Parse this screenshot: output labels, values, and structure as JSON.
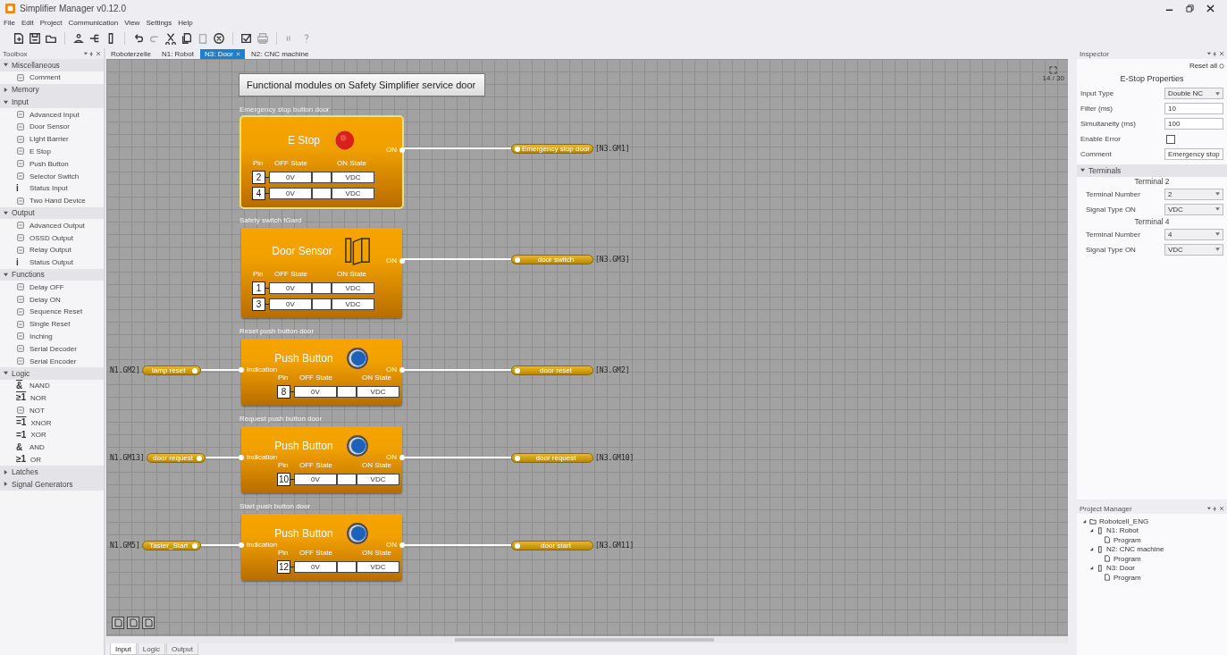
{
  "window": {
    "title": "Simplifier Manager v0.12.0"
  },
  "menu": [
    "File",
    "Edit",
    "Project",
    "Communication",
    "View",
    "Settings",
    "Help"
  ],
  "toolbox": {
    "title": "Toolbox",
    "groups": [
      {
        "label": "Miscellaneous",
        "expanded": true,
        "items": [
          {
            "label": "Comment"
          }
        ]
      },
      {
        "label": "Memory",
        "expanded": false
      },
      {
        "label": "Input",
        "expanded": true,
        "items": [
          {
            "label": "Advanced Input"
          },
          {
            "label": "Door Sensor"
          },
          {
            "label": "Light Barrier"
          },
          {
            "label": "E Stop"
          },
          {
            "label": "Push Button"
          },
          {
            "label": "Selector Switch"
          },
          {
            "label": "Status Input",
            "glyph": "i"
          },
          {
            "label": "Two Hand Device"
          }
        ]
      },
      {
        "label": "Output",
        "expanded": true,
        "items": [
          {
            "label": "Advanced Output"
          },
          {
            "label": "OSSD Output"
          },
          {
            "label": "Relay Output"
          },
          {
            "label": "Status Output",
            "glyph": "i"
          }
        ]
      },
      {
        "label": "Functions",
        "expanded": true,
        "items": [
          {
            "label": "Delay OFF"
          },
          {
            "label": "Delay ON"
          },
          {
            "label": "Sequence Reset"
          },
          {
            "label": "Single Reset"
          },
          {
            "label": "Inching"
          },
          {
            "label": "Serial Decoder"
          },
          {
            "label": "Serial Encoder"
          }
        ]
      },
      {
        "label": "Logic",
        "expanded": true,
        "items": [
          {
            "label": "NAND",
            "glyph": "&",
            "negated": true
          },
          {
            "label": "NOR",
            "glyph": "≥1",
            "negated": true
          },
          {
            "label": "NOT"
          },
          {
            "label": "XNOR",
            "glyph": "=1",
            "negated": true
          },
          {
            "label": "XOR",
            "glyph": "=1",
            "negated": false
          },
          {
            "label": "AND",
            "glyph": "&",
            "negated": false
          },
          {
            "label": "OR",
            "glyph": "≥1",
            "negated": false
          }
        ]
      },
      {
        "label": "Latches",
        "expanded": false
      },
      {
        "label": "Signal Generators",
        "expanded": false
      }
    ]
  },
  "tabs": [
    {
      "label": "Roboterzelle",
      "selected": false
    },
    {
      "label": "N1: Robot",
      "selected": false
    },
    {
      "label": "N3: Door",
      "selected": true
    },
    {
      "label": "N2: CNC machine",
      "selected": false
    }
  ],
  "canvas": {
    "heading": "Functional modules on Safety Simplifier service door",
    "zoom": "14 / 30",
    "modules": [
      {
        "caption": "Emergency stop button door",
        "kind": "estop",
        "title": "E Stop",
        "selected": true,
        "output_port": "ON",
        "output": {
          "label": "Emergency stop door",
          "ref": "[N3.GM1]"
        },
        "columns": [
          "Pin",
          "OFF State",
          "ON State"
        ],
        "pins": [
          {
            "pin": "2",
            "off": "0V",
            "on": "VDC"
          },
          {
            "pin": "4",
            "off": "0V",
            "on": "VDC"
          }
        ]
      },
      {
        "caption": "Safety switch tGard",
        "kind": "door",
        "title": "Door Sensor",
        "selected": false,
        "output_port": "ON",
        "output": {
          "label": "door switch",
          "ref": "[N3.GM3]"
        },
        "columns": [
          "Pin",
          "OFF State",
          "ON State"
        ],
        "pins": [
          {
            "pin": "1",
            "off": "0V",
            "on": "VDC"
          },
          {
            "pin": "3",
            "off": "0V",
            "on": "VDC"
          }
        ]
      },
      {
        "caption": "Reset push button door",
        "kind": "push",
        "title": "Push Button",
        "selected": false,
        "input_port": "Indication",
        "input": {
          "ref": "N1.GM2]",
          "label": "lamp reset"
        },
        "output_port": "ON",
        "output": {
          "label": "door reset",
          "ref": "[N3.GM2]"
        },
        "columns": [
          "Pin",
          "OFF State",
          "ON State"
        ],
        "pins": [
          {
            "pin": "8",
            "off": "0V",
            "on": "VDC"
          }
        ]
      },
      {
        "caption": "Request push button door",
        "kind": "push",
        "title": "Push Button",
        "selected": false,
        "input_port": "Indication",
        "input": {
          "ref": "N1.GM13]",
          "label": "door request"
        },
        "output_port": "ON",
        "output": {
          "label": "door request",
          "ref": "[N3.GM10]"
        },
        "columns": [
          "Pin",
          "OFF State",
          "ON State"
        ],
        "pins": [
          {
            "pin": "10",
            "off": "0V",
            "on": "VDC"
          }
        ]
      },
      {
        "caption": "Start push button door",
        "kind": "push",
        "title": "Push Button",
        "selected": false,
        "input_port": "Indication",
        "input": {
          "ref": "N1.GM5]",
          "label": "Taster_Start"
        },
        "output_port": "ON",
        "output": {
          "label": "door start",
          "ref": "[N3.GM11]"
        },
        "columns": [
          "Pin",
          "OFF State",
          "ON State"
        ],
        "pins": [
          {
            "pin": "12",
            "off": "0V",
            "on": "VDC"
          }
        ]
      }
    ]
  },
  "bottom_tabs": [
    {
      "label": "Input",
      "selected": true
    },
    {
      "label": "Logic",
      "selected": false
    },
    {
      "label": "Output",
      "selected": false
    }
  ],
  "inspector": {
    "title": "Inspector",
    "reset": "Reset all",
    "section": "E-Stop Properties",
    "properties": [
      {
        "label": "Input Type",
        "kind": "select",
        "value": "Double NC"
      },
      {
        "label": "Filter (ms)",
        "kind": "text",
        "value": "10"
      },
      {
        "label": "Simultaneity (ms)",
        "kind": "text",
        "value": "100"
      },
      {
        "label": "Enable Error",
        "kind": "checkbox",
        "checked": false
      },
      {
        "label": "Comment",
        "kind": "text",
        "value": "Emergency stop"
      }
    ],
    "terminals": {
      "label": "Terminals",
      "expanded": true,
      "groups": [
        {
          "title": "Terminal 2",
          "fields": [
            {
              "label": "Terminal Number",
              "kind": "select",
              "value": "2"
            },
            {
              "label": "Signal Type ON",
              "kind": "select",
              "value": "VDC"
            }
          ]
        },
        {
          "title": "Terminal 4",
          "fields": [
            {
              "label": "Terminal Number",
              "kind": "select",
              "value": "4"
            },
            {
              "label": "Signal Type ON",
              "kind": "select",
              "value": "VDC"
            }
          ]
        }
      ]
    }
  },
  "project_manager": {
    "title": "Project Manager",
    "tree": [
      {
        "label": "Robotcell_ENG",
        "kind": "project",
        "expanded": true,
        "children": [
          {
            "label": "N1: Robot",
            "kind": "device",
            "expanded": true,
            "children": [
              {
                "label": "Program",
                "kind": "program"
              }
            ]
          },
          {
            "label": "N2: CNC machine",
            "kind": "device",
            "expanded": true,
            "children": [
              {
                "label": "Program",
                "kind": "program"
              }
            ]
          },
          {
            "label": "N3: Door",
            "kind": "device",
            "expanded": true,
            "children": [
              {
                "label": "Program",
                "kind": "program"
              }
            ]
          }
        ]
      }
    ]
  }
}
